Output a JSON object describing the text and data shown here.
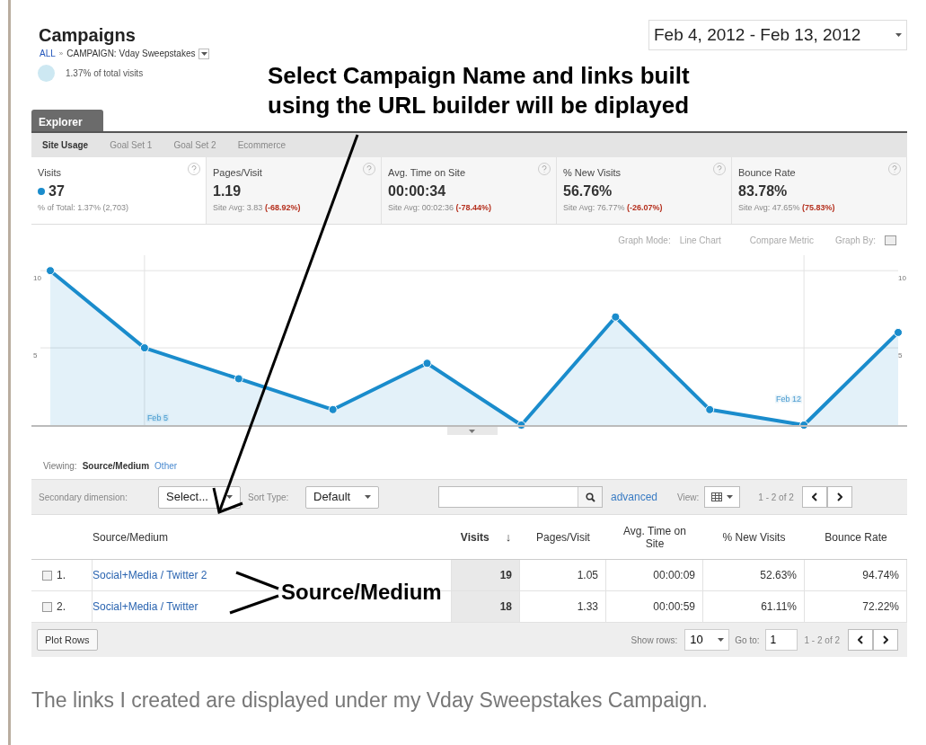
{
  "header": {
    "title": "Campaigns",
    "breadcrumb": [
      "ALL",
      "CAMPAIGN: Vday Sweepstakes"
    ],
    "breadcrumb_separator": "»",
    "share": "1.37% of total visits"
  },
  "date_range": "Feb 4, 2012 - Feb 13, 2012",
  "explorer_tab": "Explorer",
  "subtabs": [
    {
      "label": "Site Usage",
      "selected": true
    },
    {
      "label": "Goal Set 1",
      "selected": false
    },
    {
      "label": "Goal Set 2",
      "selected": false
    },
    {
      "label": "Ecommerce",
      "selected": false
    }
  ],
  "metrics": [
    {
      "label": "Visits",
      "value": "37",
      "note": "% of Total: 1.37% (2,703)",
      "selected": true
    },
    {
      "label": "Pages/Visit",
      "value": "1.19",
      "note": "Site Avg: 3.83",
      "change": "(-68.92%)",
      "selected": false
    },
    {
      "label": "Avg. Time on Site",
      "value": "00:00:34",
      "note": "Site Avg: 00:02:36",
      "change": "(-78.44%)",
      "selected": false
    },
    {
      "label": "% New Visits",
      "value": "56.76%",
      "note": "Site Avg: 76.77%",
      "change": "(-26.07%)",
      "selected": false
    },
    {
      "label": "Bounce Rate",
      "value": "83.78%",
      "note": "Site Avg: 47.65%",
      "change": "(75.83%)",
      "selected": false
    }
  ],
  "graph_controls": [
    "Graph Mode:",
    "Line Chart",
    "Compare Metric",
    "Graph By:"
  ],
  "chart_data": {
    "type": "area",
    "categories": [
      null,
      "Feb 5",
      null,
      null,
      null,
      null,
      null,
      null,
      "Feb 12",
      null
    ],
    "yticks": [
      5,
      10
    ],
    "ylim": [
      0,
      11
    ],
    "grid": true,
    "series": [
      {
        "color": "#1a8ccc",
        "values": [
          10,
          5,
          3,
          1,
          4,
          0,
          7,
          1,
          0,
          6
        ]
      }
    ]
  },
  "right_axis_ticks": [
    "10",
    "5"
  ],
  "viewing": {
    "label": "Viewing:",
    "options": [
      {
        "label": "Source/Medium",
        "selected": true
      },
      {
        "label": "Other",
        "selected": false
      }
    ]
  },
  "toolbar": {
    "secondary_label": "Secondary dimension:",
    "secondary_value": "Select...",
    "sort_label": "Sort Type:",
    "sort_value": "Default",
    "advanced": "advanced",
    "view_label": "View:",
    "range": "1 - 2 of 2"
  },
  "table": {
    "columns": [
      "Source/Medium",
      "Visits",
      "Pages/Visit",
      "Avg. Time on Site",
      "% New Visits",
      "Bounce Rate"
    ],
    "sort_mark": "↓",
    "rows": [
      {
        "index": "1.",
        "checked": false,
        "cells": [
          "Social+Media / Twitter 2",
          "19",
          "1.05",
          "00:00:09",
          "52.63%",
          "94.74%"
        ]
      },
      {
        "index": "2.",
        "checked": false,
        "cells": [
          "Social+Media / Twitter",
          "18",
          "1.33",
          "00:00:59",
          "61.11%",
          "72.22%"
        ]
      }
    ]
  },
  "footer": {
    "plot": "Plot Rows",
    "show_label": "Show rows:",
    "show_value": "10",
    "goto_label": "Go to:",
    "goto_value": "1",
    "range": "1 - 2 of 2"
  },
  "annotations": [
    "Select Campaign Name and links built using the URL builder will be diplayed",
    "Source/Medium"
  ],
  "caption": "The links I created are displayed under my Vday Sweepstakes Campaign."
}
